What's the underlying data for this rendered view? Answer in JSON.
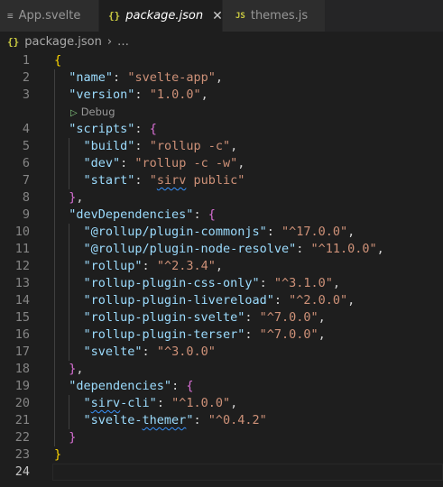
{
  "tabs": [
    {
      "label": "App.svelte",
      "icon": "≡",
      "icon_name": "svelte-file-icon",
      "active": false,
      "italic": false
    },
    {
      "label": "package.json",
      "icon": "{}",
      "icon_name": "json-file-icon",
      "active": true,
      "italic": true
    },
    {
      "label": "themes.js",
      "icon": "JS",
      "icon_name": "javascript-file-icon",
      "active": false,
      "italic": false
    }
  ],
  "breadcrumb": {
    "icon": "{}",
    "file": "package.json",
    "separator": "›",
    "more": "…"
  },
  "codelens": {
    "label": "Debug",
    "icon": "▷"
  },
  "colors": {
    "key": "#9cdcfe",
    "string": "#ce9178",
    "bracket_level1": "#ffd700",
    "bracket_level2": "#da70d6",
    "bracket_level3": "#179fff",
    "json_icon": "#cbcb41",
    "js_icon": "#cbcb41",
    "svelte_icon": "#9a9a9a"
  },
  "lines": [
    {
      "n": "1",
      "tokens": [
        {
          "t": "{",
          "c": "b1"
        }
      ]
    },
    {
      "n": "2",
      "tokens": [
        {
          "t": "  ",
          "c": "p"
        },
        {
          "t": "\"name\"",
          "c": "k"
        },
        {
          "t": ": ",
          "c": "p"
        },
        {
          "t": "\"svelte-app\"",
          "c": "s"
        },
        {
          "t": ",",
          "c": "p"
        }
      ]
    },
    {
      "n": "3",
      "tokens": [
        {
          "t": "  ",
          "c": "p"
        },
        {
          "t": "\"version\"",
          "c": "k"
        },
        {
          "t": ": ",
          "c": "p"
        },
        {
          "t": "\"1.0.0\"",
          "c": "s"
        },
        {
          "t": ",",
          "c": "p"
        }
      ]
    },
    {
      "n": "",
      "codelens": true
    },
    {
      "n": "4",
      "tokens": [
        {
          "t": "  ",
          "c": "p"
        },
        {
          "t": "\"scripts\"",
          "c": "k"
        },
        {
          "t": ": ",
          "c": "p"
        },
        {
          "t": "{",
          "c": "b2"
        }
      ]
    },
    {
      "n": "5",
      "tokens": [
        {
          "t": "    ",
          "c": "p"
        },
        {
          "t": "\"build\"",
          "c": "k"
        },
        {
          "t": ": ",
          "c": "p"
        },
        {
          "t": "\"rollup -c\"",
          "c": "s"
        },
        {
          "t": ",",
          "c": "p"
        }
      ]
    },
    {
      "n": "6",
      "tokens": [
        {
          "t": "    ",
          "c": "p"
        },
        {
          "t": "\"dev\"",
          "c": "k"
        },
        {
          "t": ": ",
          "c": "p"
        },
        {
          "t": "\"rollup -c -w\"",
          "c": "s"
        },
        {
          "t": ",",
          "c": "p"
        }
      ]
    },
    {
      "n": "7",
      "tokens": [
        {
          "t": "    ",
          "c": "p"
        },
        {
          "t": "\"start\"",
          "c": "k"
        },
        {
          "t": ": ",
          "c": "p"
        },
        {
          "t": "\"",
          "c": "s"
        },
        {
          "t": "sirv",
          "c": "s squig"
        },
        {
          "t": " public\"",
          "c": "s"
        }
      ]
    },
    {
      "n": "8",
      "tokens": [
        {
          "t": "  ",
          "c": "p"
        },
        {
          "t": "}",
          "c": "b2"
        },
        {
          "t": ",",
          "c": "p"
        }
      ]
    },
    {
      "n": "9",
      "tokens": [
        {
          "t": "  ",
          "c": "p"
        },
        {
          "t": "\"devDependencies\"",
          "c": "k"
        },
        {
          "t": ": ",
          "c": "p"
        },
        {
          "t": "{",
          "c": "b2"
        }
      ]
    },
    {
      "n": "10",
      "tokens": [
        {
          "t": "    ",
          "c": "p"
        },
        {
          "t": "\"@rollup/plugin-commonjs\"",
          "c": "k"
        },
        {
          "t": ": ",
          "c": "p"
        },
        {
          "t": "\"^17.0.0\"",
          "c": "s"
        },
        {
          "t": ",",
          "c": "p"
        }
      ]
    },
    {
      "n": "11",
      "tokens": [
        {
          "t": "    ",
          "c": "p"
        },
        {
          "t": "\"@rollup/plugin-node-resolve\"",
          "c": "k"
        },
        {
          "t": ": ",
          "c": "p"
        },
        {
          "t": "\"^11.0.0\"",
          "c": "s"
        },
        {
          "t": ",",
          "c": "p"
        }
      ]
    },
    {
      "n": "12",
      "tokens": [
        {
          "t": "    ",
          "c": "p"
        },
        {
          "t": "\"rollup\"",
          "c": "k"
        },
        {
          "t": ": ",
          "c": "p"
        },
        {
          "t": "\"^2.3.4\"",
          "c": "s"
        },
        {
          "t": ",",
          "c": "p"
        }
      ]
    },
    {
      "n": "13",
      "tokens": [
        {
          "t": "    ",
          "c": "p"
        },
        {
          "t": "\"rollup-plugin-css-only\"",
          "c": "k"
        },
        {
          "t": ": ",
          "c": "p"
        },
        {
          "t": "\"^3.1.0\"",
          "c": "s"
        },
        {
          "t": ",",
          "c": "p"
        }
      ]
    },
    {
      "n": "14",
      "tokens": [
        {
          "t": "    ",
          "c": "p"
        },
        {
          "t": "\"rollup-plugin-livereload\"",
          "c": "k"
        },
        {
          "t": ": ",
          "c": "p"
        },
        {
          "t": "\"^2.0.0\"",
          "c": "s"
        },
        {
          "t": ",",
          "c": "p"
        }
      ]
    },
    {
      "n": "15",
      "tokens": [
        {
          "t": "    ",
          "c": "p"
        },
        {
          "t": "\"rollup-plugin-svelte\"",
          "c": "k"
        },
        {
          "t": ": ",
          "c": "p"
        },
        {
          "t": "\"^7.0.0\"",
          "c": "s"
        },
        {
          "t": ",",
          "c": "p"
        }
      ]
    },
    {
      "n": "16",
      "tokens": [
        {
          "t": "    ",
          "c": "p"
        },
        {
          "t": "\"rollup-plugin-terser\"",
          "c": "k"
        },
        {
          "t": ": ",
          "c": "p"
        },
        {
          "t": "\"^7.0.0\"",
          "c": "s"
        },
        {
          "t": ",",
          "c": "p"
        }
      ]
    },
    {
      "n": "17",
      "tokens": [
        {
          "t": "    ",
          "c": "p"
        },
        {
          "t": "\"svelte\"",
          "c": "k"
        },
        {
          "t": ": ",
          "c": "p"
        },
        {
          "t": "\"^3.0.0\"",
          "c": "s"
        }
      ]
    },
    {
      "n": "18",
      "tokens": [
        {
          "t": "  ",
          "c": "p"
        },
        {
          "t": "}",
          "c": "b2"
        },
        {
          "t": ",",
          "c": "p"
        }
      ]
    },
    {
      "n": "19",
      "tokens": [
        {
          "t": "  ",
          "c": "p"
        },
        {
          "t": "\"dependencies\"",
          "c": "k"
        },
        {
          "t": ": ",
          "c": "p"
        },
        {
          "t": "{",
          "c": "b2"
        }
      ]
    },
    {
      "n": "20",
      "tokens": [
        {
          "t": "    ",
          "c": "p"
        },
        {
          "t": "\"",
          "c": "k"
        },
        {
          "t": "sirv",
          "c": "k squig"
        },
        {
          "t": "-cli\"",
          "c": "k"
        },
        {
          "t": ": ",
          "c": "p"
        },
        {
          "t": "\"^1.0.0\"",
          "c": "s"
        },
        {
          "t": ",",
          "c": "p"
        }
      ]
    },
    {
      "n": "21",
      "tokens": [
        {
          "t": "    ",
          "c": "p"
        },
        {
          "t": "\"svelte-",
          "c": "k"
        },
        {
          "t": "themer",
          "c": "k squig"
        },
        {
          "t": "\"",
          "c": "k"
        },
        {
          "t": ": ",
          "c": "p"
        },
        {
          "t": "\"^0.4.2\"",
          "c": "s"
        }
      ]
    },
    {
      "n": "22",
      "tokens": [
        {
          "t": "  ",
          "c": "p"
        },
        {
          "t": "}",
          "c": "b2"
        }
      ]
    },
    {
      "n": "23",
      "tokens": [
        {
          "t": "}",
          "c": "b1"
        }
      ]
    },
    {
      "n": "24",
      "tokens": [],
      "current": true
    }
  ]
}
